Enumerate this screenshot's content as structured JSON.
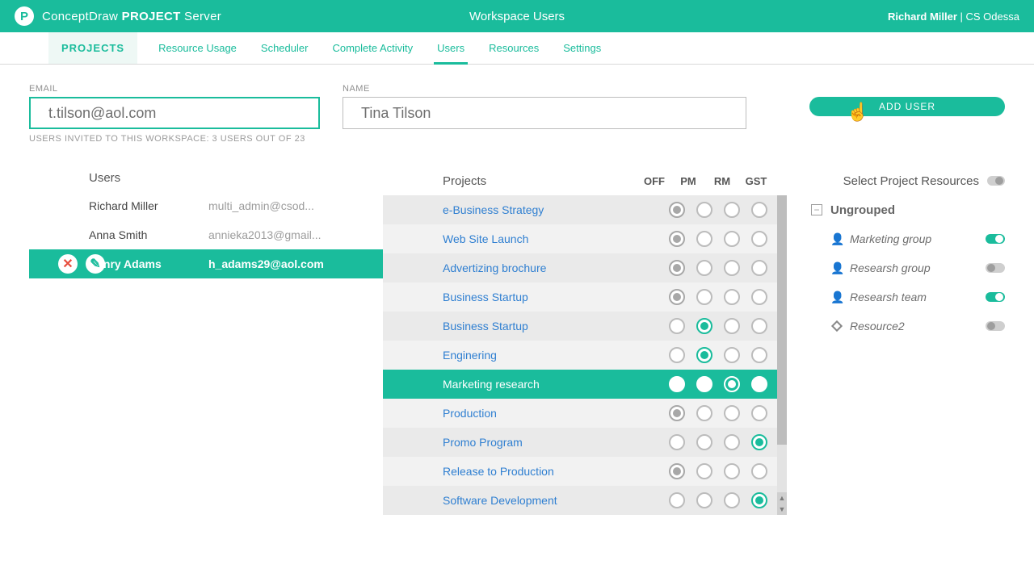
{
  "colors": {
    "accent": "#1abc9c"
  },
  "header": {
    "brand_light": "ConceptDraw ",
    "brand_bold": "PROJECT",
    "brand_suffix": " Server",
    "title": "Workspace Users",
    "user_name": "Richard Miller",
    "user_sep": " | ",
    "user_org": "CS Odessa"
  },
  "tabs": {
    "primary": "PROJECTS",
    "items": [
      "Resource Usage",
      "Scheduler",
      "Complete Activity",
      "Users",
      "Resources",
      "Settings"
    ],
    "active": "Users"
  },
  "form": {
    "email_label": "EMAIL",
    "email_value": "t.tilson@aol.com",
    "name_label": "NAME",
    "name_value": "Tina Tilson",
    "add_user": "ADD USER",
    "invited_line": "USERS INVITED TO THIS WORKSPACE: 3 USERS OUT OF 23"
  },
  "users": {
    "title": "Users",
    "rows": [
      {
        "name": "Richard Miller",
        "email": "multi_admin@csod...",
        "selected": false
      },
      {
        "name": "Anna Smith",
        "email": "annieka2013@gmail...",
        "selected": false
      },
      {
        "name": "Henry Adams",
        "email": "h_adams29@aol.com",
        "selected": true
      }
    ]
  },
  "projects": {
    "title": "Projects",
    "roles": [
      "OFF",
      "PM",
      "RM",
      "GST"
    ],
    "rows": [
      {
        "name": "e-Business Strategy",
        "state": [
          "grey-on",
          "",
          "",
          ""
        ]
      },
      {
        "name": "Web Site Launch",
        "state": [
          "grey-on",
          "",
          "",
          ""
        ]
      },
      {
        "name": "Advertizing brochure",
        "state": [
          "grey-on",
          "",
          "",
          ""
        ]
      },
      {
        "name": "Business Startup",
        "state": [
          "grey-on",
          "",
          "",
          ""
        ]
      },
      {
        "name": "Business Startup",
        "state": [
          "",
          "green",
          "",
          ""
        ]
      },
      {
        "name": "Enginering",
        "state": [
          "",
          "green",
          "",
          ""
        ]
      },
      {
        "name": "Marketing research",
        "state": [
          "solid",
          "solid",
          "ring",
          "solid"
        ],
        "selected": true
      },
      {
        "name": "Production",
        "state": [
          "grey-on",
          "",
          "",
          ""
        ]
      },
      {
        "name": "Promo Program",
        "state": [
          "",
          "",
          "",
          "green"
        ]
      },
      {
        "name": "Release to Production",
        "state": [
          "grey-on",
          "",
          "",
          ""
        ]
      },
      {
        "name": "Software Development",
        "state": [
          "",
          "",
          "",
          "green"
        ]
      }
    ]
  },
  "resources": {
    "title": "Select Project Resources",
    "group": "Ungrouped",
    "items": [
      {
        "icon": "person",
        "name": "Marketing group",
        "on": true
      },
      {
        "icon": "person",
        "name": "Researsh group",
        "on": false
      },
      {
        "icon": "person",
        "name": "Researsh team",
        "on": true
      },
      {
        "icon": "gem",
        "name": "Resource2",
        "on": false
      }
    ]
  }
}
